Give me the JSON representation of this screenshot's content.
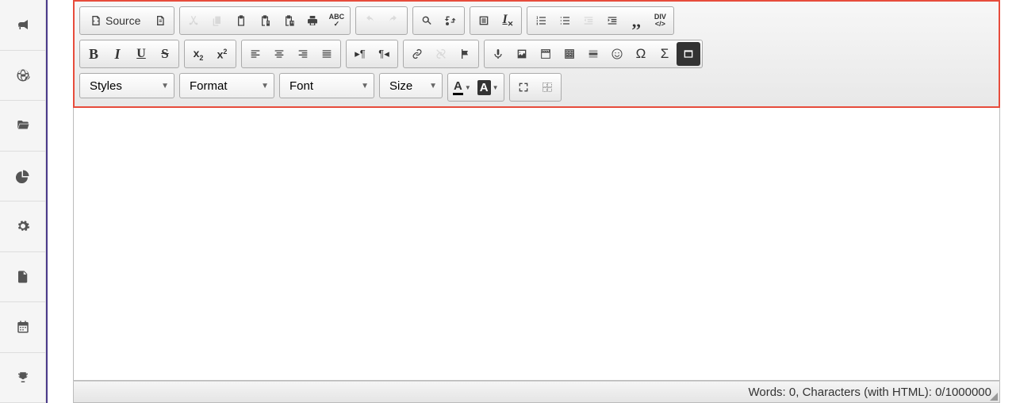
{
  "sidebar": {
    "items": [
      {
        "name": "announcements",
        "icon": "bullhorn"
      },
      {
        "name": "globe",
        "icon": "globe"
      },
      {
        "name": "files",
        "icon": "folder-open"
      },
      {
        "name": "reports",
        "icon": "pie-chart"
      },
      {
        "name": "settings",
        "icon": "gear"
      },
      {
        "name": "documents",
        "icon": "file"
      },
      {
        "name": "calendar",
        "icon": "calendar"
      },
      {
        "name": "achievements",
        "icon": "trophy"
      }
    ]
  },
  "toolbar": {
    "source_label": "Source",
    "abc_label": "ABC",
    "div_label": "DIV",
    "styles_label": "Styles",
    "format_label": "Format",
    "font_label": "Font",
    "size_label": "Size",
    "text_color_letter": "A",
    "bg_color_letter": "A",
    "bold": "B",
    "italic": "I",
    "underline": "U",
    "strike": "S",
    "sub": "x",
    "sup": "x"
  },
  "status": {
    "text": "Words: 0, Characters (with HTML): 0/1000000"
  }
}
